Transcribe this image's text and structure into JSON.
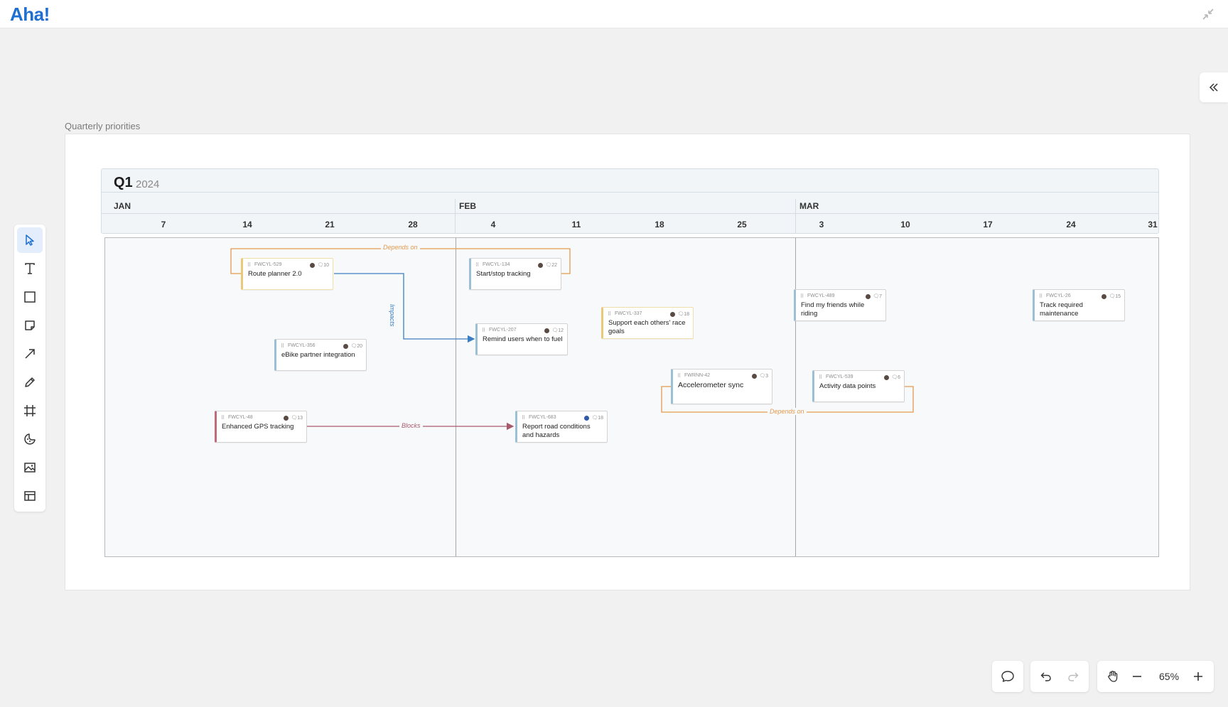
{
  "app": {
    "logo": "Aha!"
  },
  "frame": {
    "title": "Quarterly priorities"
  },
  "timeline": {
    "quarter": "Q1",
    "year": "2024",
    "months": [
      "JAN",
      "FEB",
      "MAR"
    ],
    "days": [
      "7",
      "14",
      "21",
      "28",
      "4",
      "11",
      "18",
      "25",
      "3",
      "10",
      "17",
      "24",
      "31"
    ]
  },
  "cards": [
    {
      "id": "FWCYL-529",
      "title": "Route planner 2.0",
      "count": "10",
      "color": "yellow"
    },
    {
      "id": "FWCYL-134",
      "title": "Start/stop tracking",
      "count": "22",
      "color": "blue"
    },
    {
      "id": "FWCYL-207",
      "title": "Remind users when to fuel",
      "count": "12",
      "color": "blue"
    },
    {
      "id": "FWCYL-337",
      "title": "Support each others' race goals",
      "count": "18",
      "color": "yellow"
    },
    {
      "id": "FWCYL-356",
      "title": "eBike partner integration",
      "count": "20",
      "color": "blue"
    },
    {
      "id": "FWRNN-42",
      "title": "Accelerometer sync",
      "count": "3",
      "color": "blue"
    },
    {
      "id": "FWCYL-48",
      "title": "Enhanced GPS tracking",
      "count": "13",
      "color": "red"
    },
    {
      "id": "FWCYL-683",
      "title": "Report road conditions and hazards",
      "count": "18",
      "color": "blue"
    },
    {
      "id": "FWCYL-489",
      "title": "Find my friends while riding",
      "count": "7",
      "color": "blue"
    },
    {
      "id": "FWCYL-539",
      "title": "Activity data points",
      "count": "6",
      "color": "blue"
    },
    {
      "id": "FWCYL-26",
      "title": "Track required maintenance",
      "count": "15",
      "color": "blue"
    }
  ],
  "links": {
    "depends_on_1": "Depends on",
    "impacts": "Impacts",
    "blocks": "Blocks",
    "depends_on_2": "Depends on"
  },
  "zoom": {
    "level": "65%"
  },
  "colors": {
    "brand": "#1f6fd1",
    "depends": "#e39a4e",
    "impacts": "#3b7fc0",
    "blocks": "#a85a6c"
  }
}
